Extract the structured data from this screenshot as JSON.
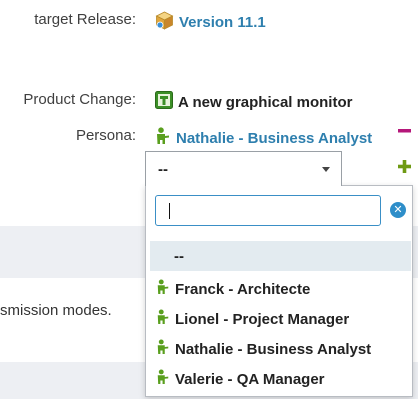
{
  "fields": {
    "target_release": {
      "label": "target Release:",
      "value": "Version 11.1",
      "icon": "release-box-icon"
    },
    "product_change": {
      "label": "Product Change:",
      "value": "A new graphical monitor",
      "icon": "product-change-icon"
    },
    "persona": {
      "label": "Persona:",
      "value": "Nathalie - Business Analyst",
      "icon": "person-icon"
    }
  },
  "persona_select": {
    "selected": "--",
    "search_value": "",
    "options": [
      {
        "label": "--",
        "icon": ""
      },
      {
        "label": "Franck - Architecte",
        "icon": "person-icon"
      },
      {
        "label": "Lionel - Project Manager",
        "icon": "person-icon"
      },
      {
        "label": "Nathalie - Business Analyst",
        "icon": "person-icon"
      },
      {
        "label": "Valerie - QA Manager",
        "icon": "person-icon"
      }
    ]
  },
  "background_text": "smission modes.",
  "colors": {
    "link": "#2e7fae",
    "remove": "#b5177a",
    "add": "#6f9a14",
    "person": "#5a9f1e",
    "highlight": "#e3ebf0",
    "focus": "#3a8fc6"
  }
}
